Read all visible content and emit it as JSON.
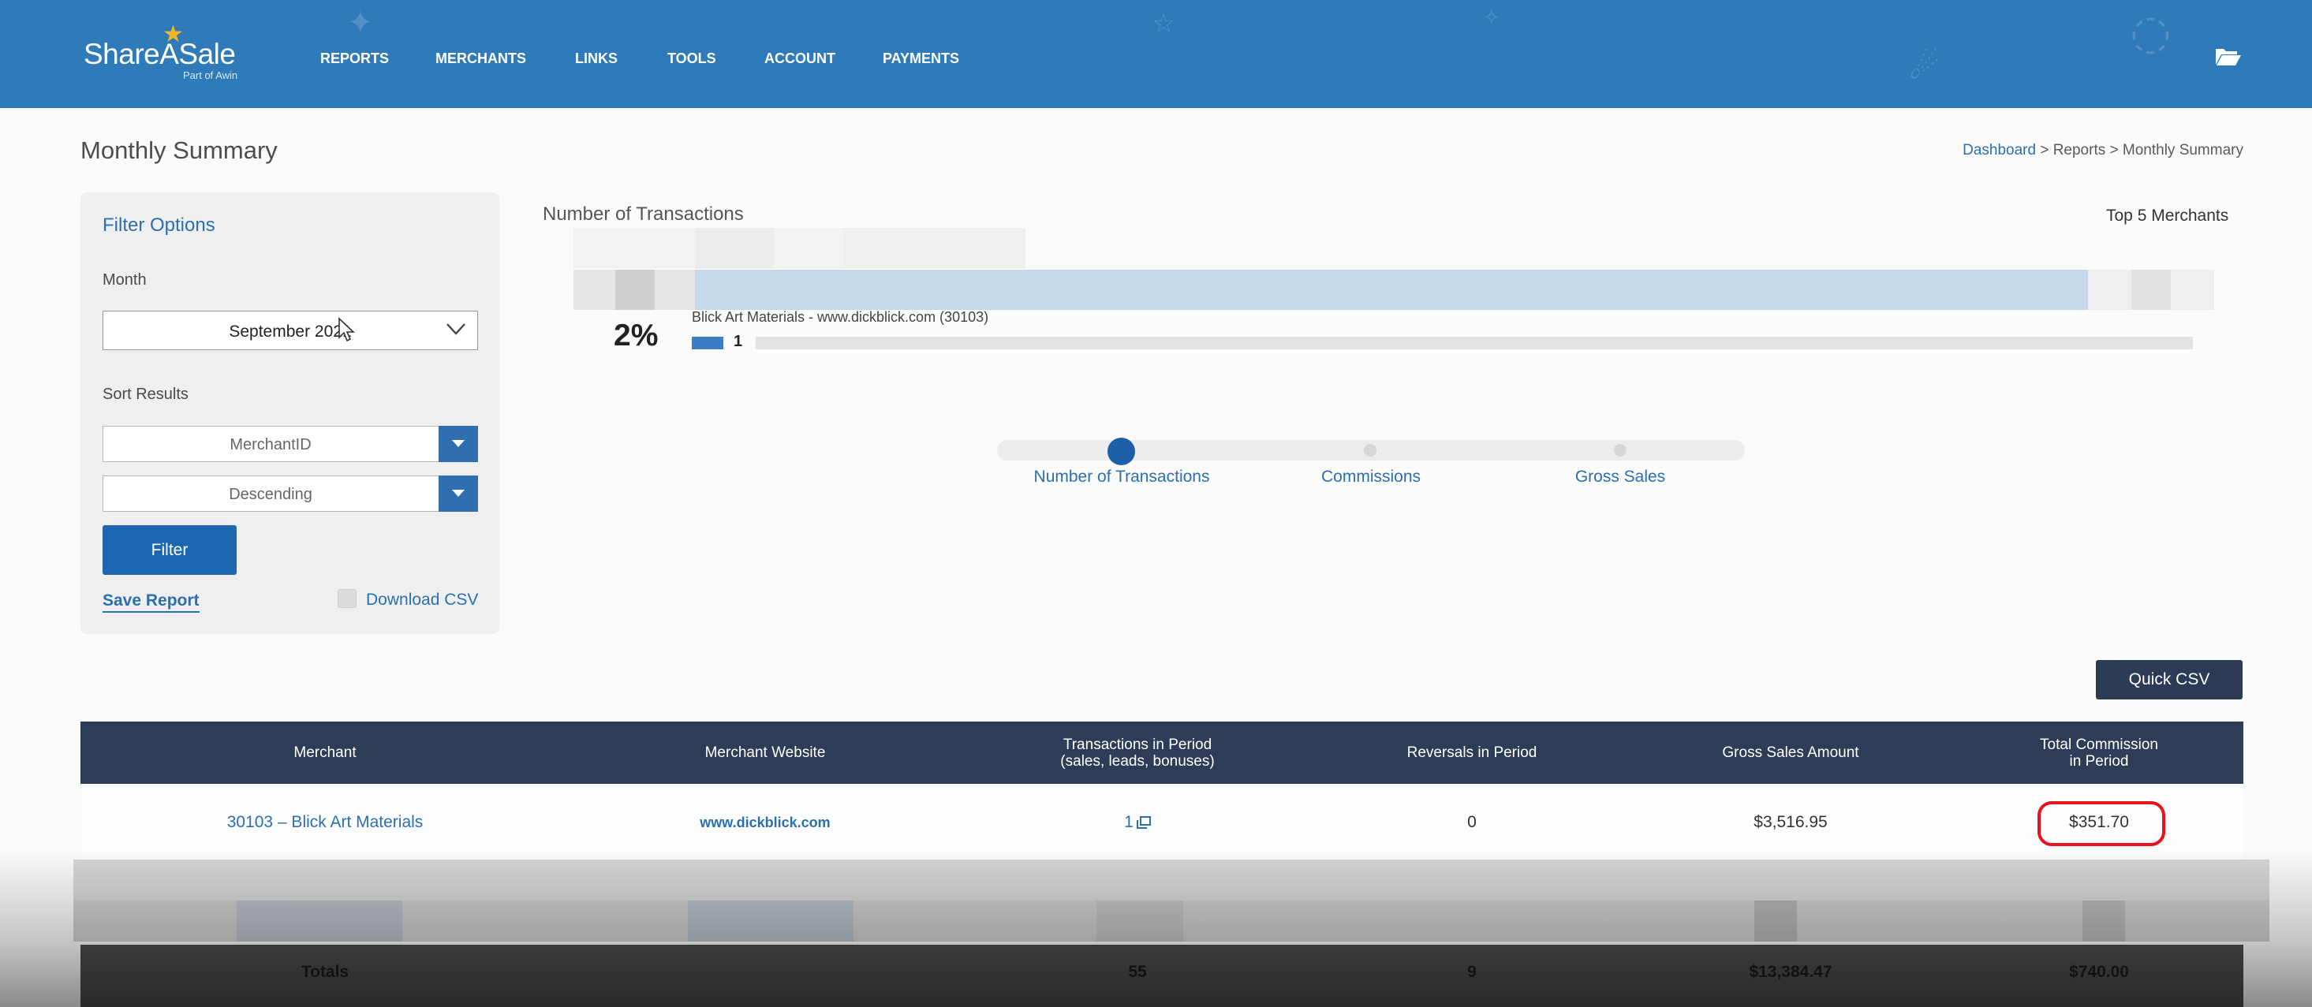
{
  "brand": {
    "name": "ShareASale",
    "tagline": "Part of Awin",
    "logo_star_color": "#f3b724"
  },
  "nav": [
    "REPORTS",
    "MERCHANTS",
    "LINKS",
    "TOOLS",
    "ACCOUNT",
    "PAYMENTS"
  ],
  "header_icon": "folder-open-icon",
  "page": {
    "title": "Monthly Summary",
    "breadcrumb": {
      "home": "Dashboard",
      "sep1": " > ",
      "section": "Reports",
      "sep2": " > ",
      "current": "Monthly Summary"
    }
  },
  "filter": {
    "title": "Filter Options",
    "month_label": "Month",
    "month_value": "September 2021",
    "sort_label": "Sort Results",
    "sort_by": "MerchantID",
    "sort_order": "Descending",
    "filter_button": "Filter",
    "save_report": "Save Report",
    "download_csv": "Download CSV"
  },
  "chart": {
    "title": "Number of Transactions",
    "top_label": "Top 5 Merchants",
    "percent": "2%",
    "merchant_label": "Blick Art Materials - www.dickblick.com (30103)",
    "count": "1"
  },
  "metric_switcher": {
    "options": [
      "Number of Transactions",
      "Commissions",
      "Gross Sales"
    ],
    "selected": "Number of Transactions"
  },
  "quick_csv": "Quick CSV",
  "table": {
    "headers": [
      "Merchant",
      "Merchant Website",
      "Transactions in Period",
      "(sales, leads, bonuses)",
      "Reversals in Period",
      "Gross Sales Amount",
      "Total Commission",
      "in Period"
    ],
    "row": {
      "merchant": "30103 – Blick Art Materials",
      "website": "www.dickblick.com",
      "transactions": "1",
      "reversals": "0",
      "gross_sales": "$3,516.95",
      "commission": "$351.70"
    },
    "totals": {
      "label": "Totals",
      "transactions": "55",
      "reversals": "9",
      "gross_sales": "$13,384.47",
      "commission": "$740.00"
    }
  },
  "colors": {
    "header_bg": "#2f7bb9",
    "accent": "#2b6fb3",
    "table_header": "#2e3d57",
    "highlight": "#e6121c"
  }
}
